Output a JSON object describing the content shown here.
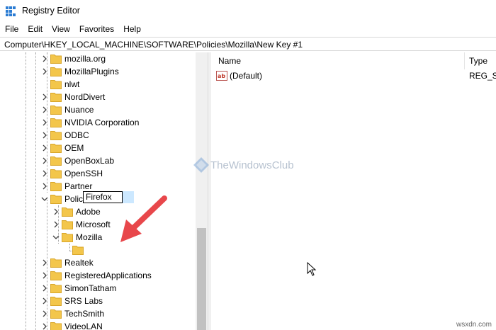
{
  "window": {
    "title": "Registry Editor"
  },
  "menu": [
    "File",
    "Edit",
    "View",
    "Favorites",
    "Help"
  ],
  "address": "Computer\\HKEY_LOCAL_MACHINE\\SOFTWARE\\Policies\\Mozilla\\New Key #1",
  "tree": {
    "items": [
      {
        "label": "mozilla.org"
      },
      {
        "label": "MozillaPlugins"
      },
      {
        "label": "nlwt"
      },
      {
        "label": "NordDivert"
      },
      {
        "label": "Nuance"
      },
      {
        "label": "NVIDIA Corporation"
      },
      {
        "label": "ODBC"
      },
      {
        "label": "OEM"
      },
      {
        "label": "OpenBoxLab"
      },
      {
        "label": "OpenSSH"
      },
      {
        "label": "Partner"
      },
      {
        "label": "Policies"
      },
      {
        "label": "Adobe"
      },
      {
        "label": "Microsoft"
      },
      {
        "label": "Mozilla"
      },
      {
        "label": "Firefox"
      },
      {
        "label": "Realtek"
      },
      {
        "label": "RegisteredApplications"
      },
      {
        "label": "SimonTatham"
      },
      {
        "label": "SRS Labs"
      },
      {
        "label": "TechSmith"
      },
      {
        "label": "VideoLAN"
      }
    ]
  },
  "list": {
    "columns": [
      "Name",
      "Type"
    ],
    "rows": [
      {
        "name": "(Default)",
        "type": "REG_SZ"
      }
    ]
  },
  "watermark": "TheWindowsClub",
  "footer": "wsxdn.com",
  "colors": {
    "folder": "#f3c64b",
    "arrow": "#e8474b",
    "selection": "#cce8ff"
  }
}
